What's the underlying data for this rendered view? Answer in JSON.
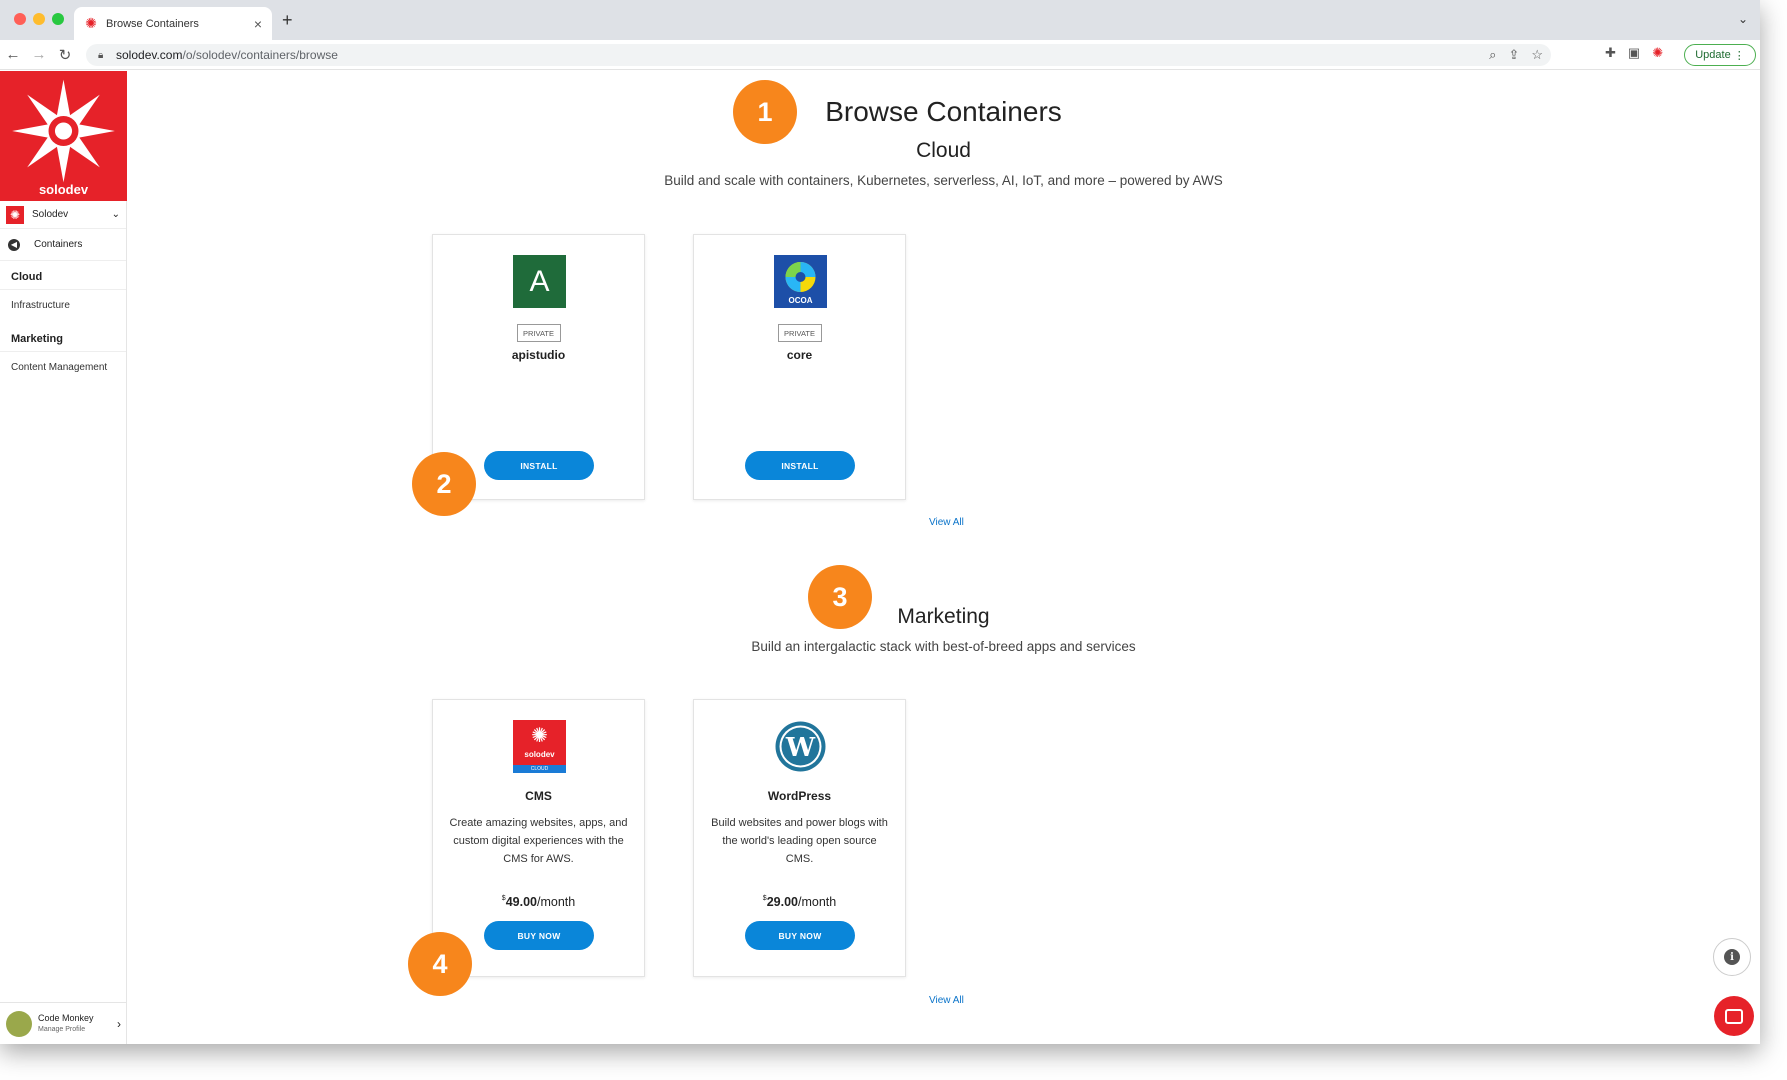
{
  "browser": {
    "tab_title": "Browse Containers",
    "new_tab": "+",
    "url_host": "solodev.com",
    "url_path": "/o/solodev/containers/browse",
    "update_label": "Update"
  },
  "sidebar": {
    "brand_name": "solodev",
    "org_name": "Solodev",
    "back_link": "Containers",
    "sections": [
      {
        "title": "Cloud",
        "item": "Infrastructure"
      },
      {
        "title": "Marketing",
        "item": "Content Management"
      }
    ],
    "profile": {
      "name": "Code Monkey",
      "sub": "Manage Profile"
    }
  },
  "page": {
    "title": "Browse Containers",
    "cloud": {
      "heading": "Cloud",
      "subtitle": "Build and scale with containers, Kubernetes, serverless, AI, IoT, and more – powered by AWS",
      "cards": [
        {
          "logo_letter": "A",
          "badge": "PRIVATE",
          "name": "apistudio",
          "button": "INSTALL"
        },
        {
          "logo_text": "OCOA",
          "badge": "PRIVATE",
          "name": "core",
          "button": "INSTALL"
        }
      ],
      "view_all": "View All"
    },
    "marketing": {
      "heading": "Marketing",
      "subtitle": "Build an intergalactic stack with best-of-breed apps and services",
      "cards": [
        {
          "logo_text": "solodev",
          "logo_sub": "CLOUD",
          "name": "CMS",
          "description": "Create amazing websites, apps, and custom digital experiences with the CMS for AWS.",
          "currency": "$",
          "price": "49.00",
          "period": "/month",
          "button": "BUY NOW"
        },
        {
          "logo_text": "W",
          "name": "WordPress",
          "description": "Build websites and power blogs with the world's leading open source CMS.",
          "currency": "$",
          "price": "29.00",
          "period": "/month",
          "button": "BUY NOW"
        }
      ],
      "view_all": "View All"
    }
  },
  "callouts": [
    "1",
    "2",
    "3",
    "4"
  ],
  "colors": {
    "brand_red": "#e62229",
    "button_blue": "#0a86d9",
    "callout_orange": "#f7861c"
  }
}
